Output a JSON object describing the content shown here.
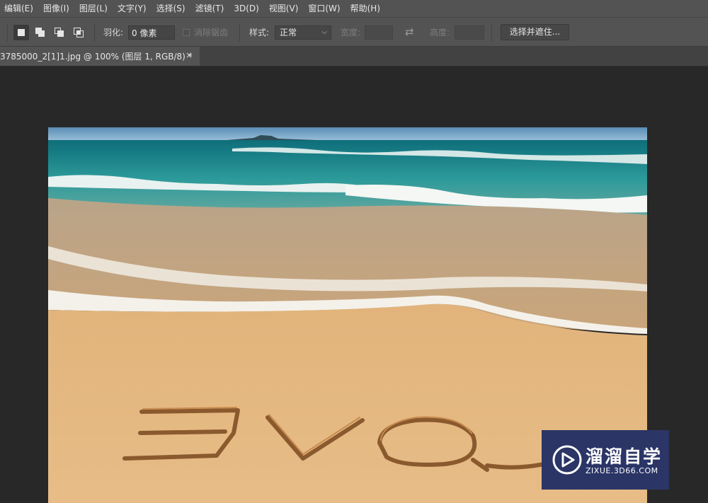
{
  "menu": {
    "items": [
      "编辑(E)",
      "图像(I)",
      "图层(L)",
      "文字(Y)",
      "选择(S)",
      "滤镜(T)",
      "3D(D)",
      "视图(V)",
      "窗口(W)",
      "帮助(H)"
    ]
  },
  "options": {
    "selection_modes": [
      {
        "icon": "new-selection-icon",
        "active": true
      },
      {
        "icon": "add-to-selection-icon",
        "active": false
      },
      {
        "icon": "subtract-from-selection-icon",
        "active": false
      },
      {
        "icon": "intersect-selection-icon",
        "active": false
      }
    ],
    "feather_label": "羽化:",
    "feather_value": "0 像素",
    "antialias_label": "消除锯齿",
    "style_label": "样式:",
    "style_value": "正常",
    "width_label": "宽度:",
    "height_label": "高度:",
    "select_mask_button": "选择并遮住..."
  },
  "document": {
    "tab_title": "3785000_2[1]1.jpg  @  100%  (图层 1, RGB/8) *",
    "close_glyph": "×"
  },
  "canvas": {
    "image_description": "beach photo with sand writing"
  },
  "watermark": {
    "title": "溜溜自学",
    "url": "ZIXUE.3D66.COM"
  },
  "colors": {
    "menu_bg": "#535353",
    "workspace_bg": "#282828",
    "watermark_bg": "#2b3566"
  }
}
